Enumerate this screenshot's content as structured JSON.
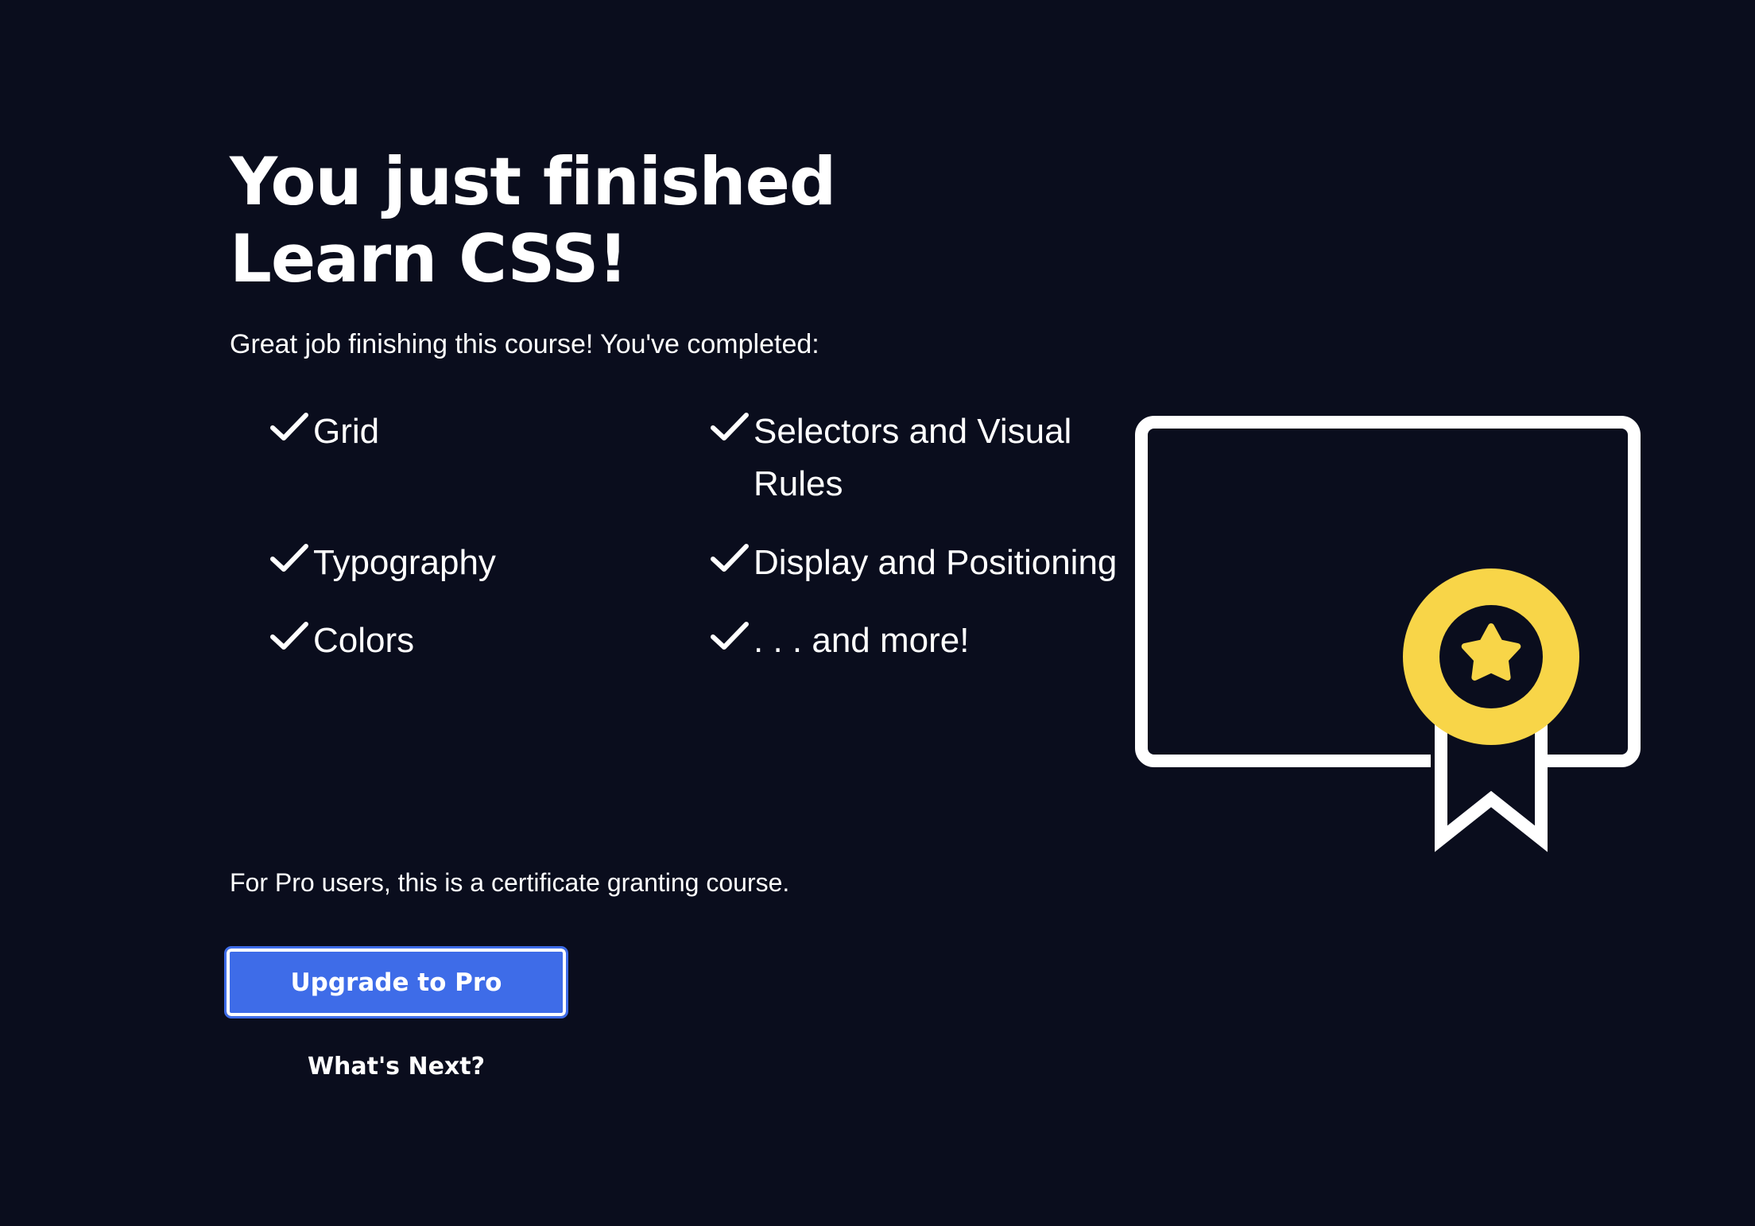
{
  "heading": {
    "line1": "You just finished",
    "line2": "Learn CSS!"
  },
  "intro_text": "Great job finishing this course! You've completed:",
  "topics": [
    {
      "label": "Grid"
    },
    {
      "label": "Selectors and Visual Rules"
    },
    {
      "label": "Typography"
    },
    {
      "label": "Display and Positioning"
    },
    {
      "label": "Colors"
    },
    {
      "label": ". . . and more!"
    }
  ],
  "pro_note": "For Pro users, this is a certificate granting course.",
  "actions": {
    "upgrade_label": "Upgrade to Pro",
    "whats_next_label": "What's Next?"
  },
  "colors": {
    "background": "#0a0d1d",
    "button": "#3e6ce8",
    "medal": "#f8d548",
    "text": "#ffffff"
  },
  "icons": {
    "topic_check": "checkmark-icon",
    "illustration": "certificate-icon"
  }
}
